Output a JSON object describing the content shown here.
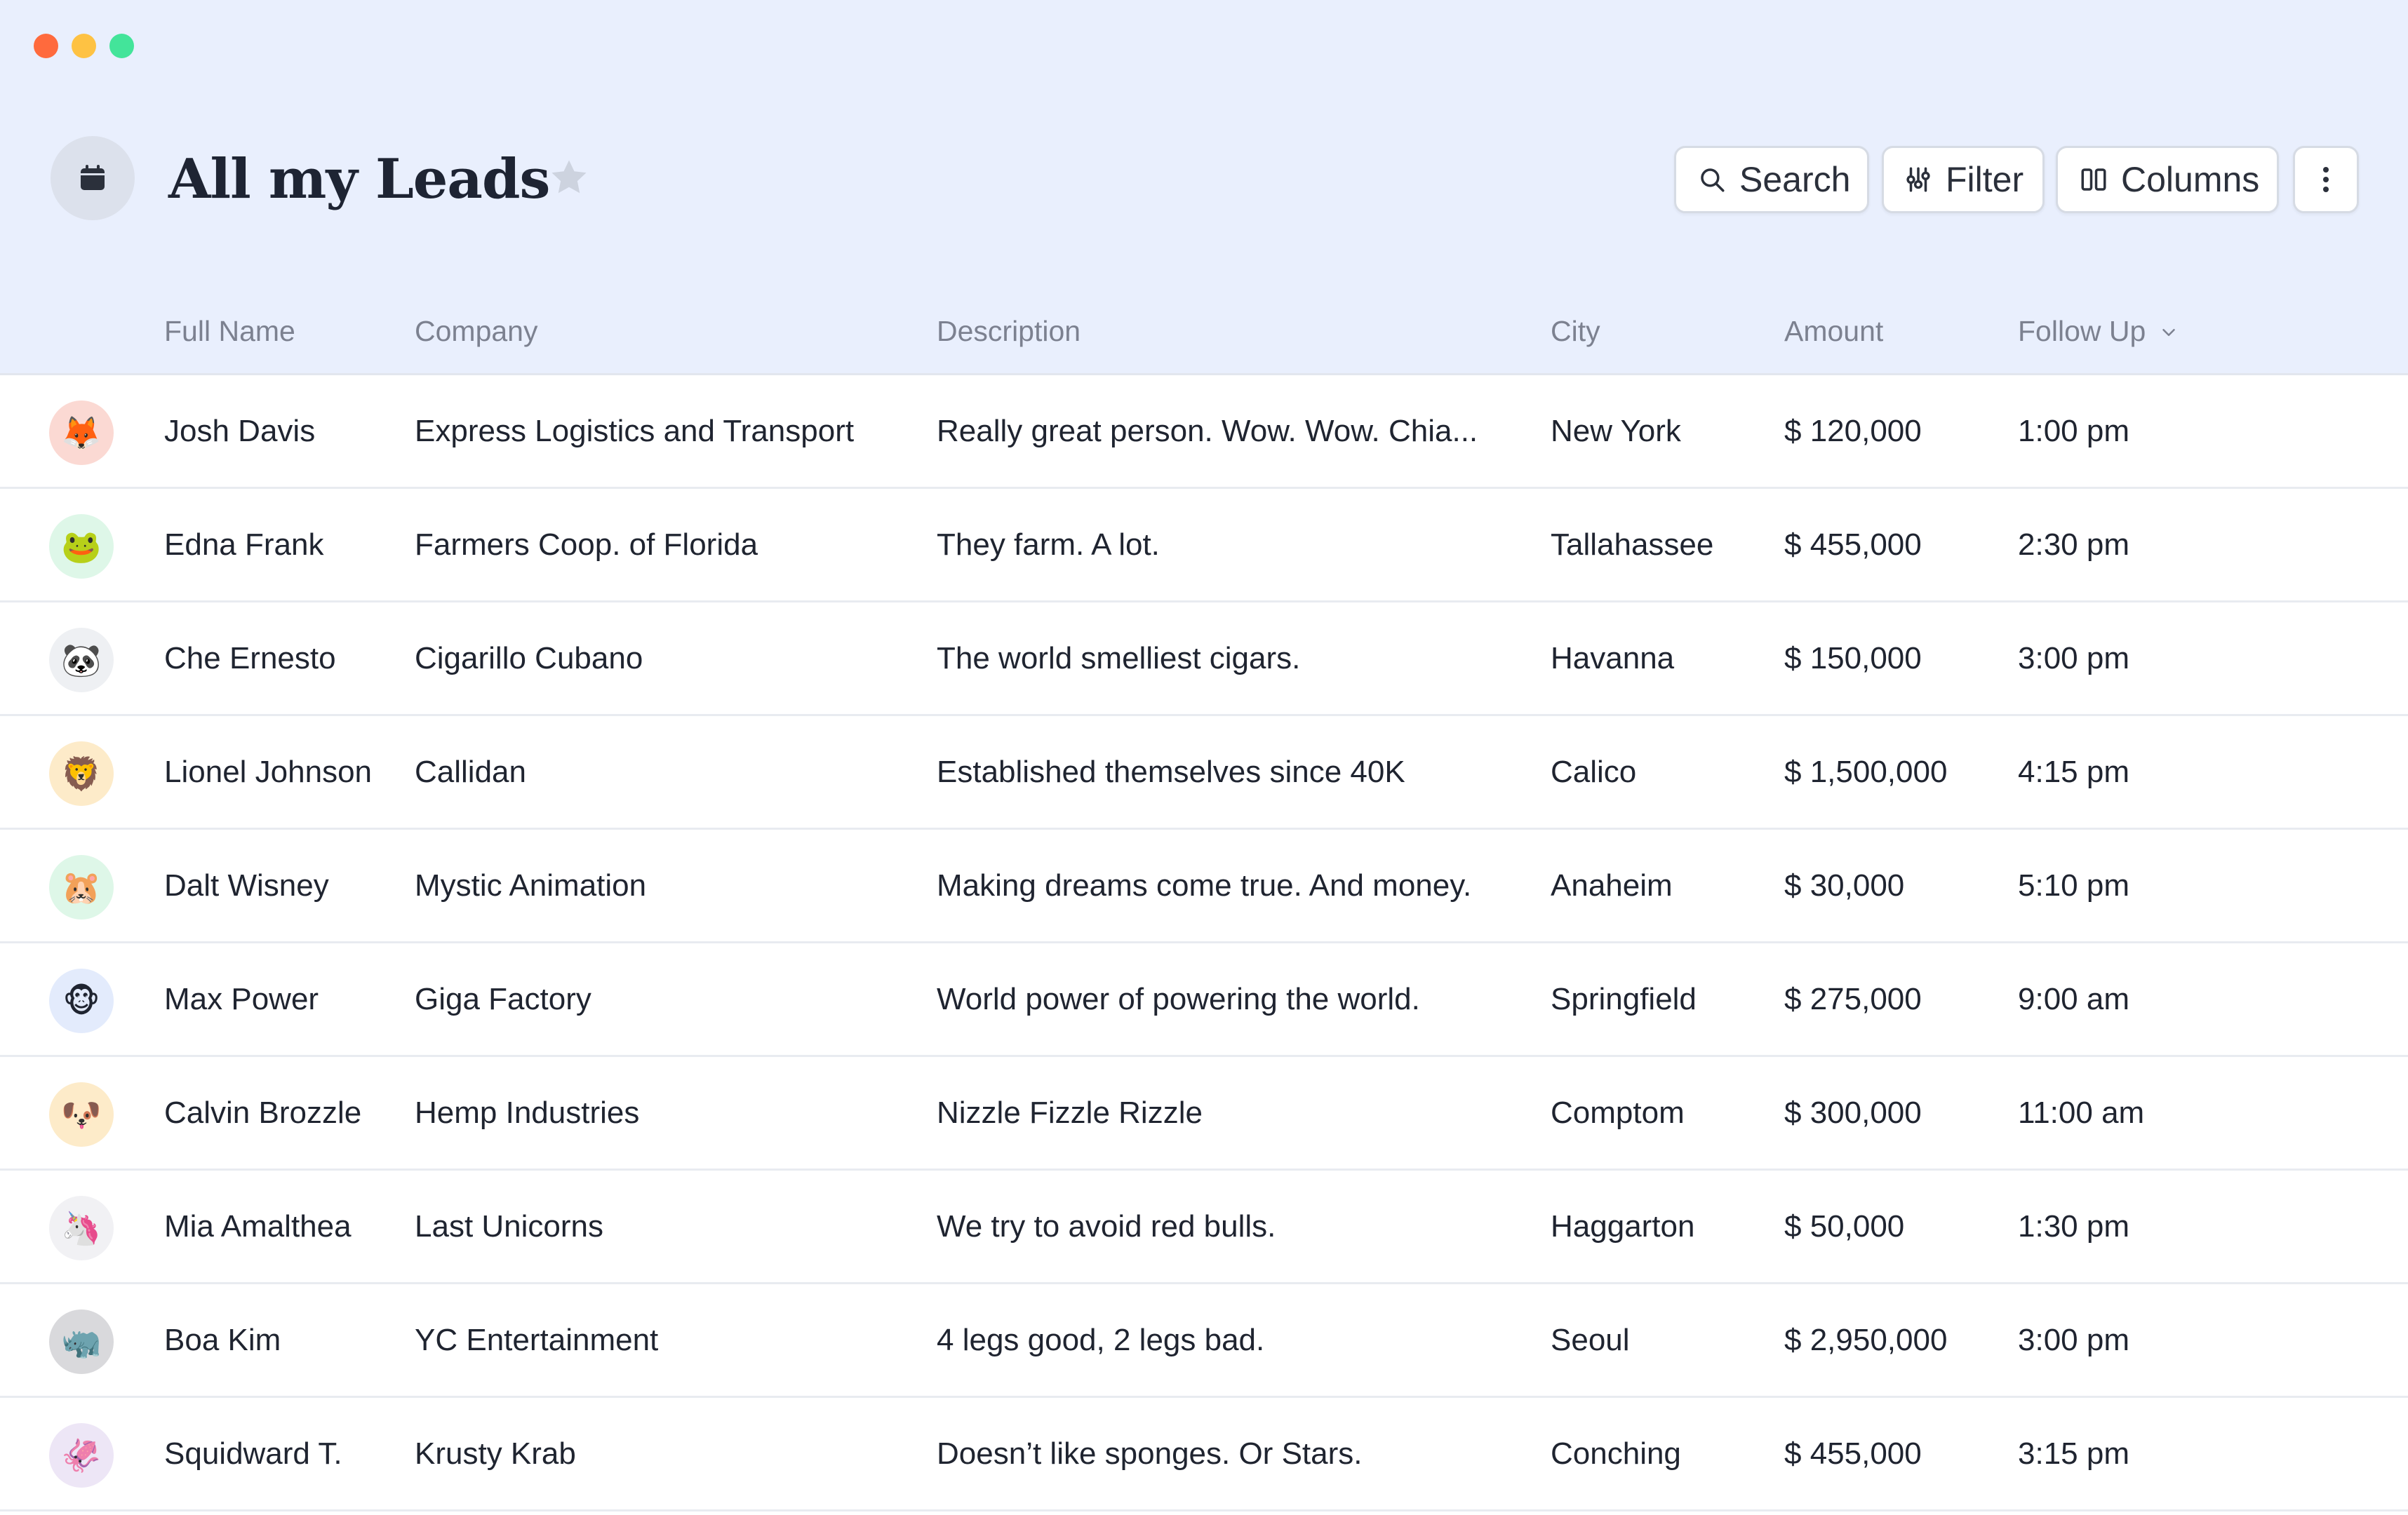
{
  "window": {
    "controls": [
      "close",
      "minimize",
      "maximize"
    ]
  },
  "page": {
    "title": "All my Leads",
    "icon": "calendar-icon",
    "favorite_icon": "star-icon"
  },
  "toolbar": {
    "search_label": "Search",
    "filter_label": "Filter",
    "columns_label": "Columns",
    "more_icon": "more-vertical-icon"
  },
  "table": {
    "columns": {
      "full_name": "Full Name",
      "company": "Company",
      "description": "Description",
      "city": "City",
      "amount": "Amount",
      "follow_up": "Follow Up"
    },
    "rows": [
      {
        "avatar": "🦊",
        "avatar_bg": "#fbd9d3",
        "name": "Josh Davis",
        "company": "Express Logistics and Transport",
        "description": "Really great person. Wow. Wow. Chia...",
        "city": "New York",
        "amount": "$ 120,000",
        "follow_up": "1:00 pm"
      },
      {
        "avatar": "🐸",
        "avatar_bg": "#def7e8",
        "name": "Edna Frank",
        "company": "Farmers Coop. of Florida",
        "description": "They farm. A lot.",
        "city": "Tallahassee",
        "amount": "$ 455,000",
        "follow_up": "2:30 pm"
      },
      {
        "avatar": "🐼",
        "avatar_bg": "#eef0f3",
        "name": "Che Ernesto",
        "company": "Cigarillo Cubano",
        "description": "The world smelliest cigars.",
        "city": "Havanna",
        "amount": "$ 150,000",
        "follow_up": "3:00 pm"
      },
      {
        "avatar": "🦁",
        "avatar_bg": "#fdebc9",
        "name": "Lionel Johnson",
        "company": "Callidan",
        "description": "Established themselves since 40K",
        "city": "Calico",
        "amount": "$ 1,500,000",
        "follow_up": "4:15 pm"
      },
      {
        "avatar": "🐹",
        "avatar_bg": "#def7e8",
        "name": "Dalt Wisney",
        "company": "Mystic Animation",
        "description": "Making dreams come true. And money.",
        "city": "Anaheim",
        "amount": "$ 30,000",
        "follow_up": "5:10 pm"
      },
      {
        "avatar": "🐵",
        "avatar_bg": "#e3ebfc",
        "name": "Max Power",
        "company": "Giga Factory",
        "description": "World power of powering the world.",
        "city": "Springfield",
        "amount": "$ 275,000",
        "follow_up": "9:00 am"
      },
      {
        "avatar": "🐶",
        "avatar_bg": "#fdebc9",
        "name": "Calvin Brozzle",
        "company": "Hemp Industries",
        "description": "Nizzle Fizzle Rizzle",
        "city": "Comptom",
        "amount": "$ 300,000",
        "follow_up": "11:00 am"
      },
      {
        "avatar": "🦄",
        "avatar_bg": "#f1f1f4",
        "name": "Mia Amalthea",
        "company": "Last Unicorns",
        "description": "We try to avoid red bulls.",
        "city": "Haggarton",
        "amount": "$ 50,000",
        "follow_up": "1:30 pm"
      },
      {
        "avatar": "🦏",
        "avatar_bg": "#d9d9dc",
        "name": "Boa Kim",
        "company": "YC Entertainment",
        "description": "4 legs good, 2 legs bad.",
        "city": "Seoul",
        "amount": "$ 2,950,000",
        "follow_up": "3:00 pm"
      },
      {
        "avatar": "🦑",
        "avatar_bg": "#ede6f6",
        "name": "Squidward T.",
        "company": "Krusty Krab",
        "description": "Doesn’t like sponges. Or Stars.",
        "city": "Conching",
        "amount": "$ 455,000",
        "follow_up": "3:15 pm"
      }
    ]
  },
  "colors": {
    "header_background": "#e9effd",
    "traffic_red": "#ff6a3d",
    "traffic_yellow": "#fec243",
    "traffic_green": "#43e49a",
    "header_text": "#7c8190",
    "row_text": "#1f2430"
  }
}
